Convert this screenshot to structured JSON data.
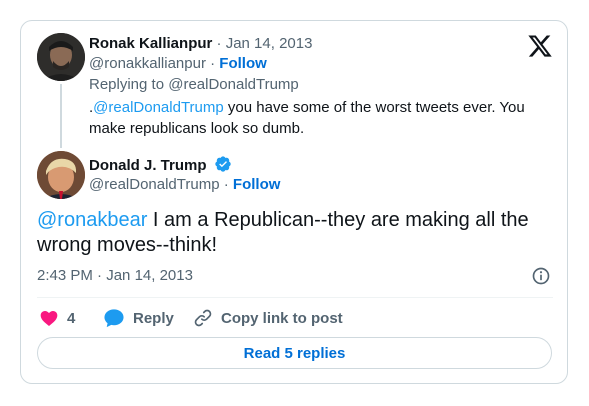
{
  "reply_tweet": {
    "author_name": "Ronak Kallianpur",
    "date_separator": "·",
    "date": "Jan 14, 2013",
    "handle": "@ronakkallianpur",
    "follow_separator": "·",
    "follow_label": "Follow",
    "replying_prefix": "Replying to ",
    "replying_to": "@realDonaldTrump",
    "text_lead": ".",
    "text_mention": "@realDonaldTrump",
    "text_body": " you have  some of the worst tweets ever. You make republicans look so dumb."
  },
  "main_tweet": {
    "author_name": "Donald J. Trump",
    "handle": "@realDonaldTrump",
    "follow_separator": "·",
    "follow_label": "Follow",
    "text_mention": "@ronakbear",
    "text_body": "  I am a Republican--they are making all the wrong moves--think!",
    "time": "2:43 PM",
    "time_separator": "·",
    "date": "Jan 14, 2013"
  },
  "actions": {
    "like_count": "4",
    "reply_label": "Reply",
    "copy_link_label": "Copy link to post"
  },
  "read_replies_label": "Read 5 replies",
  "colors": {
    "link": "#1d9bf0",
    "follow": "#006fd6",
    "like": "#f91880",
    "verified": "#1d9bf0",
    "muted": "#536471"
  },
  "icons": [
    "x-logo-icon",
    "verified-badge-icon",
    "info-icon",
    "heart-icon",
    "reply-bubble-icon",
    "link-icon"
  ]
}
